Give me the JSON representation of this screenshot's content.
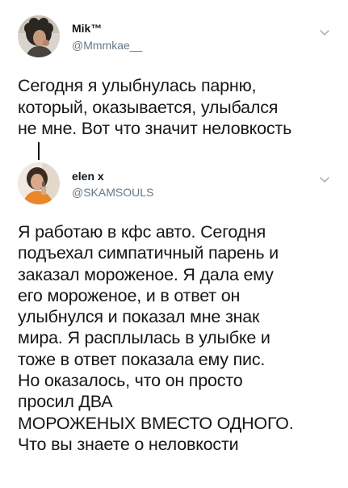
{
  "tweets": [
    {
      "name": "Mik™",
      "handle": "@Mmmkae__",
      "text": "Сегодня я улыбнулась парню,\nкоторый, оказывается, улыбался\nне мне. Вот что значит неловкость",
      "avatar_icon": "profile-photo-woman-curly-hair",
      "menu_icon": "chevron-down-icon"
    },
    {
      "name": "elen x",
      "handle": "@SKAMSOULS",
      "text": "Я работаю в кфс авто. Сегодня\nподъехал симпатичный парень и\nзаказал мороженое. Я дала ему\nего мороженое, и в ответ он\nулыбнулся и показал мне знак\nмира. Я расплылась в улыбке и\nтоже в ответ показала ему пис.\nНо оказалось, что он просто\nпросил ДВА\nМОРОЖЕНЫХ ВМЕСТО ОДНОГО.\nЧто вы знаете о неловкости",
      "avatar_icon": "profile-photo-woman-orange-shirt",
      "menu_icon": "chevron-down-icon"
    }
  ],
  "colors": {
    "text": "#14171a",
    "secondary_text": "#657786",
    "chevron": "#aab8c2",
    "thread_line": "#14171a"
  }
}
